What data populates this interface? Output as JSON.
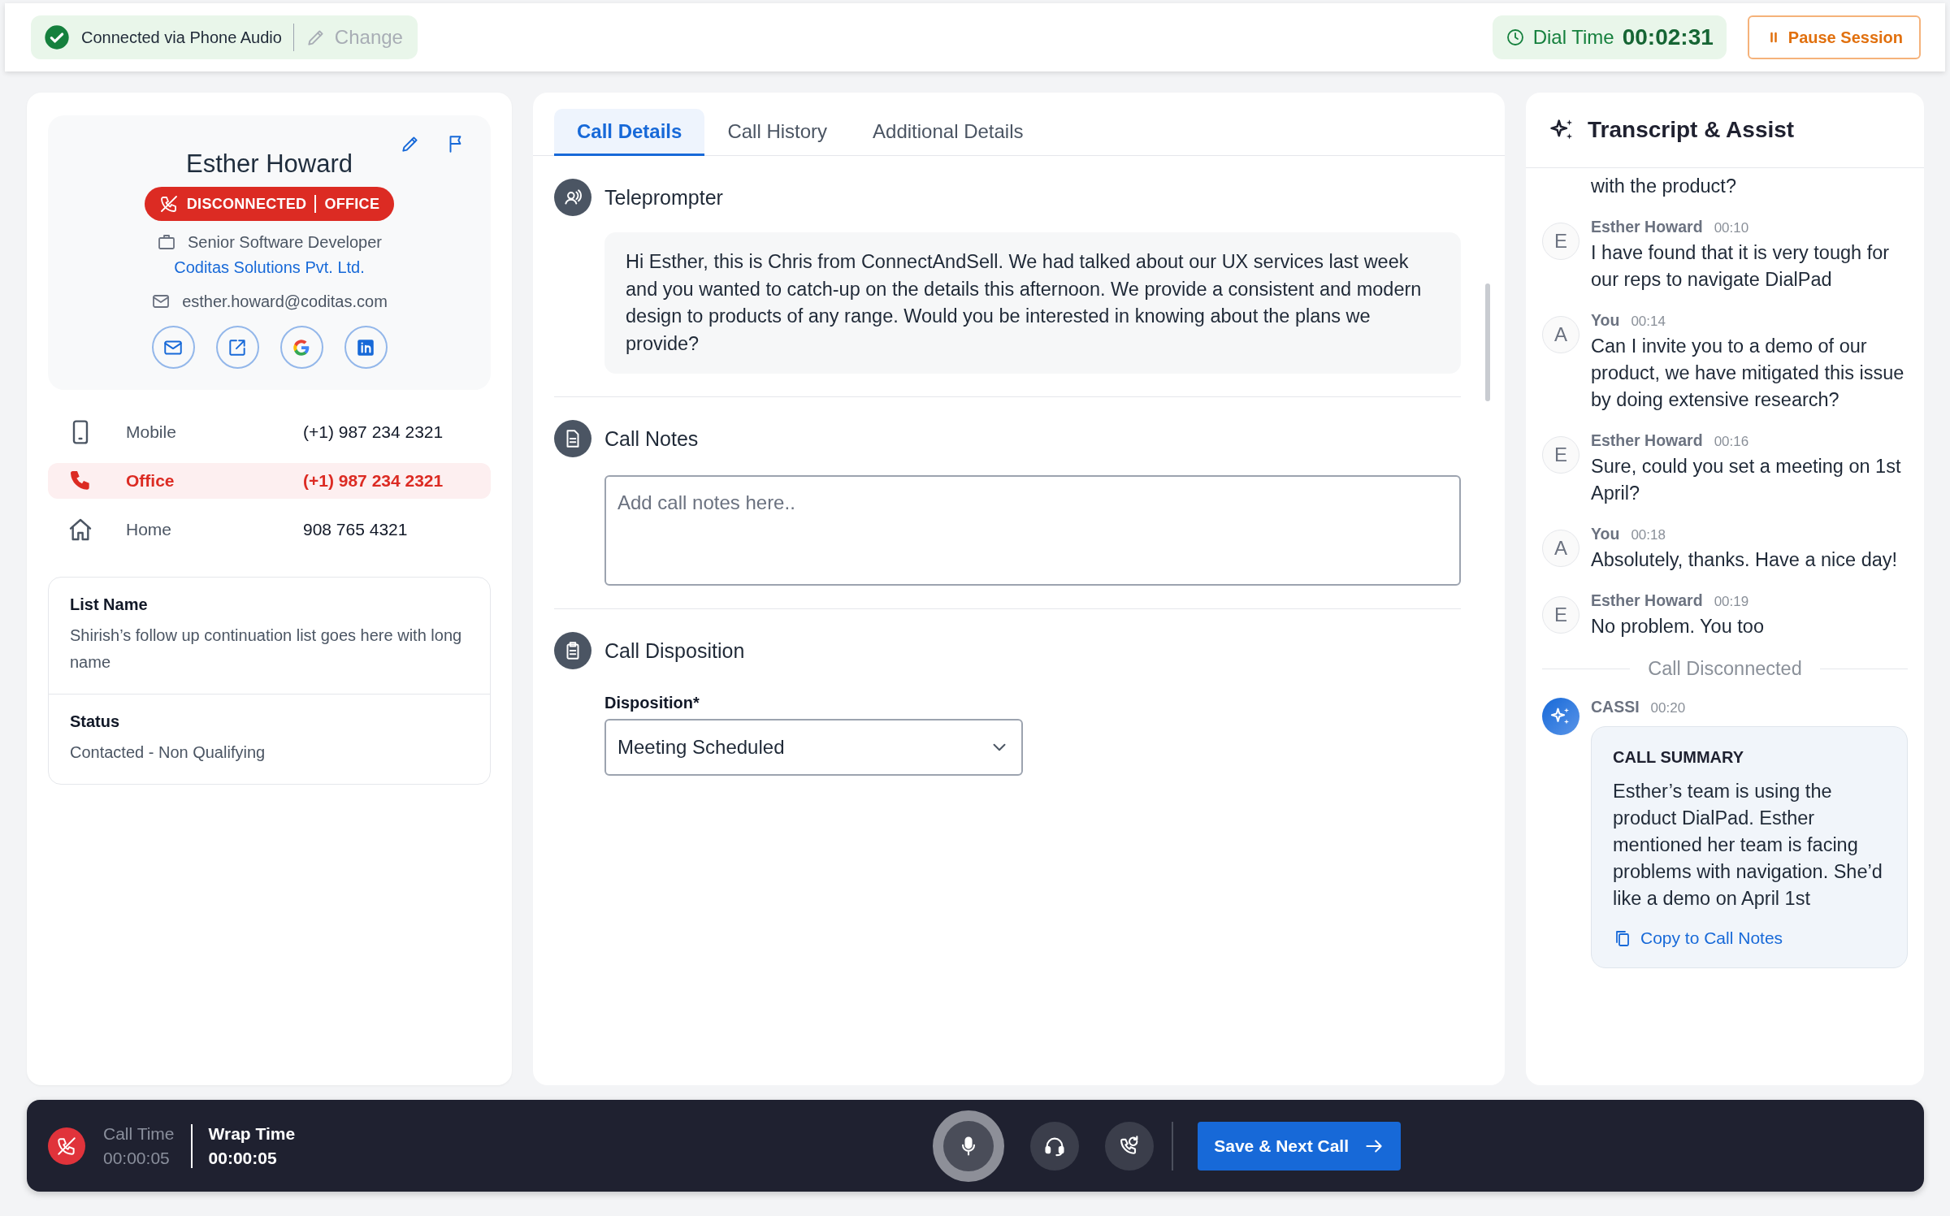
{
  "top_bar": {
    "connection": "Connected via Phone Audio",
    "change": {
      "label": "Change",
      "disabled": true
    },
    "dial_time_label": "Dial Time",
    "dial_time": "00:02:31",
    "pause_button": "Pause Session"
  },
  "contact": {
    "name": "Esther Howard",
    "status_badge": [
      "DISCONNECTED",
      "OFFICE"
    ],
    "job_title": "Senior Software Developer",
    "company": "Coditas Solutions Pvt. Ltd.",
    "email": "esther.howard@coditas.com",
    "links": [
      {
        "kind": "mail"
      },
      {
        "kind": "external"
      },
      {
        "kind": "google"
      },
      {
        "kind": "linkedin"
      }
    ],
    "phones": [
      {
        "kind": "mobile",
        "label": "Mobile",
        "number": "(+1) 987 234 2321",
        "selected": false
      },
      {
        "kind": "office",
        "label": "Office",
        "number": "(+1) 987 234 2321",
        "selected": true
      },
      {
        "kind": "home",
        "label": "Home",
        "number": "908 765 4321",
        "selected": false
      }
    ],
    "list_name_label": "List Name",
    "list_name": "Shirish’s follow up continuation list goes here with long name",
    "status_label": "Status",
    "status": "Contacted - Non Qualifying"
  },
  "tabs": [
    {
      "label": "Call Details",
      "selected": true
    },
    {
      "label": "Call History",
      "selected": false
    },
    {
      "label": "Additional Details",
      "selected": false
    }
  ],
  "teleprompter": {
    "title": "Teleprompter",
    "text": "Hi Esther, this is Chris from ConnectAndSell. We had talked about our UX services last week and you wanted to catch-up on the details this afternoon. We provide a consistent and modern design to products of any range. Would you be interested in knowing about the plans we provide?"
  },
  "call_notes": {
    "title": "Call Notes",
    "placeholder": "Add call notes here.."
  },
  "call_disposition": {
    "title": "Call Disposition",
    "label": "Disposition*",
    "value": "Meeting Scheduled"
  },
  "transcript": {
    "title": "Transcript & Assist",
    "items": [
      {
        "kind": "partial",
        "text": "with the product?"
      },
      {
        "kind": "message",
        "initial": "E",
        "speaker": "Esther Howard",
        "time": "00:10",
        "text": "I have found that it is very tough for our reps to navigate DialPad"
      },
      {
        "kind": "message",
        "initial": "A",
        "speaker": "You",
        "time": "00:14",
        "text": "Can I invite you to a demo of our product, we have mitigated this issue by doing extensive research?"
      },
      {
        "kind": "message",
        "initial": "E",
        "speaker": "Esther Howard",
        "time": "00:16",
        "text": "Sure, could you set a meeting on 1st April?"
      },
      {
        "kind": "message",
        "initial": "A",
        "speaker": "You",
        "time": "00:18",
        "text": "Absolutely, thanks. Have a nice day!"
      },
      {
        "kind": "message",
        "initial": "E",
        "speaker": "Esther Howard",
        "time": "00:19",
        "text": "No problem. You too"
      },
      {
        "kind": "divider",
        "text": "Call Disconnected"
      },
      {
        "kind": "summary",
        "speaker": "CASSI",
        "time": "00:20",
        "heading": "CALL SUMMARY",
        "text": "Esther’s team is using the product DialPad. Esther mentioned her team is facing problems with navigation. She’d like a demo on April 1st",
        "action": "Copy to Call Notes"
      }
    ]
  },
  "call_bar": {
    "call_time_label": "Call Time",
    "call_time": "00:00:05",
    "wrap_time_label": "Wrap Time",
    "wrap_time": "00:00:05",
    "controls": [
      {
        "kind": "mic",
        "active": true
      },
      {
        "kind": "headset",
        "active": false
      },
      {
        "kind": "transfer",
        "active": false
      }
    ],
    "save_button": "Save & Next Call"
  }
}
